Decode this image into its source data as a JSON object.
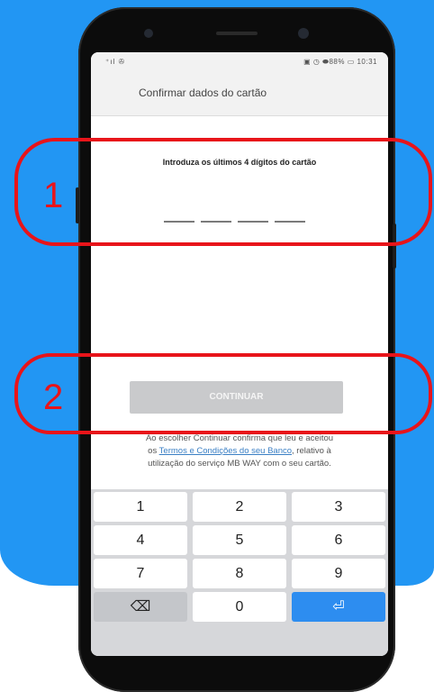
{
  "status_bar": {
    "left_icons": "⁺ıl ✇",
    "right_text": "▣ ◷ ⬬88% ▭ 10:31"
  },
  "header": {
    "title": "Confirmar dados do cartão"
  },
  "form": {
    "prompt": "Introduza os últimos 4 dígitos do cartão",
    "digits": [
      "",
      "",
      "",
      ""
    ],
    "continue_label": "CONTINUAR"
  },
  "terms": {
    "line1": "Ao escolher Continuar confirma que leu e aceitou",
    "line2_prefix": "os ",
    "link": "Termos e Condições do seu Banco",
    "line2_suffix": ", relativo à",
    "line3": "utilização do serviço MB WAY com o seu cartão."
  },
  "keypad": {
    "keys": [
      "1",
      "2",
      "3",
      "4",
      "5",
      "6",
      "7",
      "8",
      "9"
    ],
    "zero": "0",
    "backspace_icon": "⌫",
    "enter_icon": "⏎"
  },
  "annotations": {
    "one": "1",
    "two": "2"
  },
  "colors": {
    "background_blue": "#2296f3",
    "annotation_red": "#e8141a",
    "key_blue": "#2d8df0"
  }
}
